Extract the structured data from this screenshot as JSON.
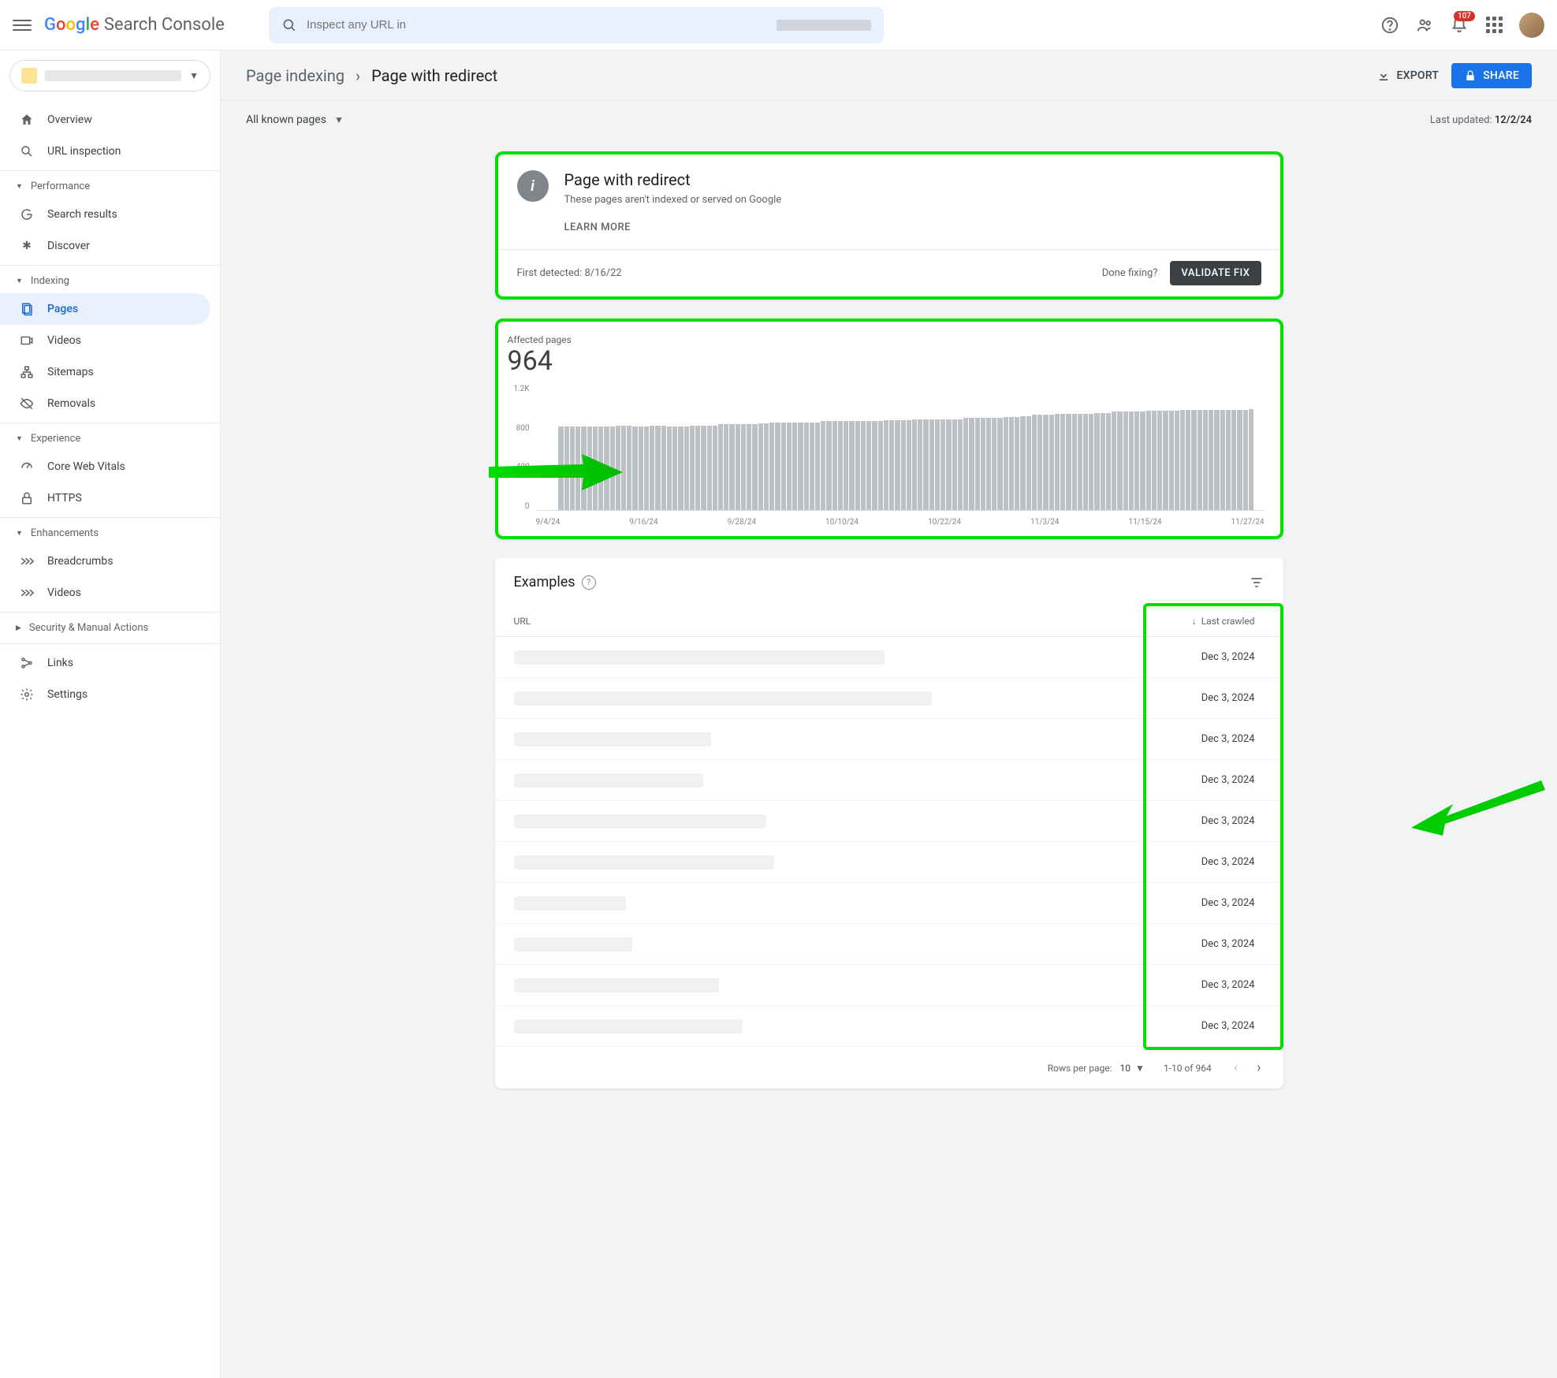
{
  "header": {
    "logo_suffix": "Search Console",
    "search_placeholder": "Inspect any URL in",
    "notification_count": "107"
  },
  "sidebar": {
    "overview": "Overview",
    "url_inspection": "URL inspection",
    "sections": {
      "performance": {
        "label": "Performance",
        "items": [
          "Search results",
          "Discover"
        ]
      },
      "indexing": {
        "label": "Indexing",
        "items": [
          "Pages",
          "Videos",
          "Sitemaps",
          "Removals"
        ]
      },
      "experience": {
        "label": "Experience",
        "items": [
          "Core Web Vitals",
          "HTTPS"
        ]
      },
      "enhancements": {
        "label": "Enhancements",
        "items": [
          "Breadcrumbs",
          "Videos"
        ]
      },
      "security": {
        "label": "Security & Manual Actions"
      }
    },
    "links": "Links",
    "settings": "Settings"
  },
  "breadcrumb": {
    "parent": "Page indexing",
    "current": "Page with redirect",
    "export": "EXPORT",
    "share": "SHARE"
  },
  "filter": {
    "dropdown": "All known pages",
    "last_updated_label": "Last updated:",
    "last_updated_date": "12/2/24"
  },
  "info_card": {
    "title": "Page with redirect",
    "subtitle": "These pages aren't indexed or served on Google",
    "learn_more": "LEARN MORE",
    "first_detected": "First detected: 8/16/22",
    "done_fixing": "Done fixing?",
    "validate": "VALIDATE FIX"
  },
  "chart": {
    "label": "Affected pages",
    "value": "964"
  },
  "chart_data": {
    "type": "bar",
    "title": "Affected pages",
    "ylabel": "",
    "xlabel": "",
    "ylim": [
      0,
      1200
    ],
    "y_ticks": [
      "1.2K",
      "800",
      "400",
      "0"
    ],
    "x_ticks": [
      "9/4/24",
      "9/16/24",
      "9/28/24",
      "10/10/24",
      "10/22/24",
      "11/3/24",
      "11/15/24",
      "11/27/24"
    ],
    "values": [
      0,
      0,
      0,
      0,
      800,
      800,
      800,
      800,
      800,
      800,
      800,
      800,
      800,
      800,
      805,
      805,
      810,
      800,
      800,
      800,
      810,
      810,
      810,
      800,
      800,
      800,
      800,
      810,
      810,
      810,
      810,
      810,
      820,
      820,
      820,
      820,
      820,
      820,
      820,
      830,
      830,
      840,
      840,
      840,
      840,
      840,
      840,
      840,
      840,
      840,
      850,
      850,
      850,
      850,
      850,
      850,
      850,
      850,
      850,
      850,
      850,
      860,
      860,
      860,
      860,
      860,
      870,
      870,
      870,
      870,
      870,
      870,
      870,
      870,
      870,
      880,
      880,
      880,
      880,
      880,
      880,
      880,
      890,
      890,
      890,
      900,
      900,
      910,
      910,
      910,
      910,
      920,
      920,
      920,
      920,
      920,
      920,
      920,
      930,
      930,
      930,
      940,
      940,
      940,
      940,
      940,
      940,
      950,
      950,
      950,
      950,
      950,
      950,
      955,
      955,
      955,
      955,
      955,
      955,
      955,
      960,
      960,
      960,
      960,
      960,
      964,
      0,
      0
    ]
  },
  "examples": {
    "title": "Examples",
    "col_url": "URL",
    "col_crawled": "Last crawled",
    "url_widths": [
      470,
      530,
      250,
      240,
      320,
      330,
      142,
      150,
      260,
      290
    ],
    "rows": [
      {
        "crawled": "Dec 3, 2024"
      },
      {
        "crawled": "Dec 3, 2024"
      },
      {
        "crawled": "Dec 3, 2024"
      },
      {
        "crawled": "Dec 3, 2024"
      },
      {
        "crawled": "Dec 3, 2024"
      },
      {
        "crawled": "Dec 3, 2024"
      },
      {
        "crawled": "Dec 3, 2024"
      },
      {
        "crawled": "Dec 3, 2024"
      },
      {
        "crawled": "Dec 3, 2024"
      },
      {
        "crawled": "Dec 3, 2024"
      }
    ],
    "rows_per_page_label": "Rows per page:",
    "rows_per_page_value": "10",
    "range": "1-10 of 964"
  }
}
